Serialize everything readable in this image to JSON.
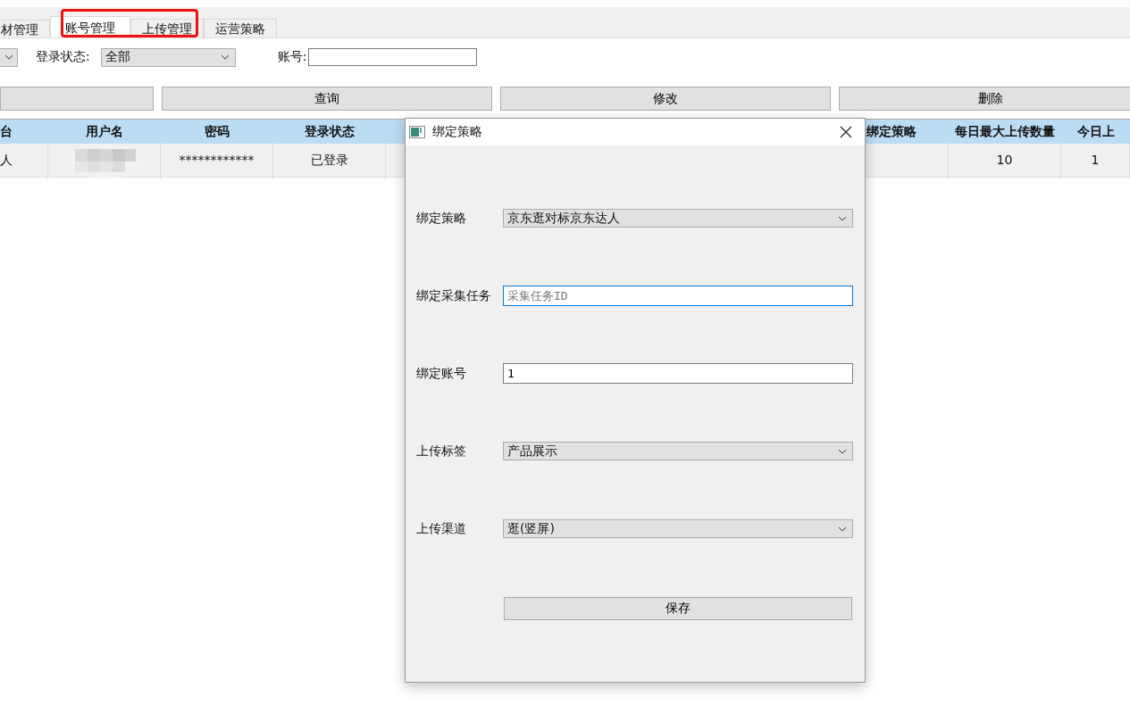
{
  "tabs": [
    {
      "label": "材管理",
      "selected": false
    },
    {
      "label": "账号管理",
      "selected": true
    },
    {
      "label": "上传管理",
      "selected": false
    },
    {
      "label": "运营策略",
      "selected": false
    }
  ],
  "filters": {
    "login_status": {
      "label": "登录状态:",
      "value": "全部"
    },
    "account": {
      "label": "账号:"
    }
  },
  "buttons": [
    "查询",
    "修改",
    "删除"
  ],
  "table": {
    "columns": {
      "platform": "台",
      "username": "用户名",
      "password": "密码",
      "login_status": "登录状态",
      "strategy": "绑定策略",
      "daily_max": "每日最大上传数量",
      "today": "今日上"
    },
    "rows": [
      {
        "platform": "人",
        "password": "************",
        "login_status": "已登录",
        "daily_max": "10",
        "today": "1"
      }
    ]
  },
  "dialog": {
    "title": "绑定策略",
    "fields": [
      {
        "kind": "select",
        "label": "绑定策略",
        "value": "京东逛对标京东达人"
      },
      {
        "kind": "input",
        "label": "绑定采集任务",
        "placeholder": "采集任务ID",
        "focused": true
      },
      {
        "kind": "input",
        "label": "绑定账号",
        "value": "1",
        "focused": false
      },
      {
        "kind": "select",
        "label": "上传标签",
        "value": "产品展示"
      },
      {
        "kind": "select",
        "label": "上传渠道",
        "value": "逛(竖屏)"
      }
    ],
    "save_button": "保存"
  }
}
